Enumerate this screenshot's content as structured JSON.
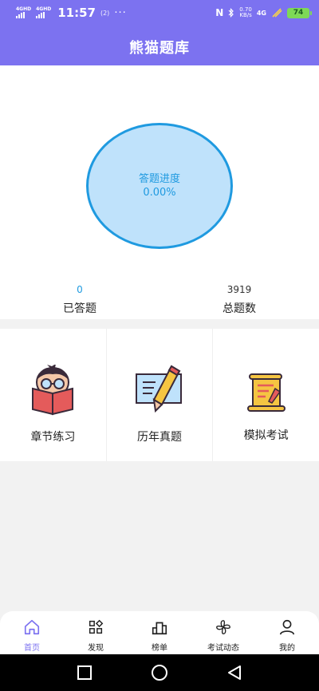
{
  "status_bar": {
    "network1": "4GHD",
    "network2": "4GHD",
    "time": "11:57",
    "hd_badge": "(2)",
    "more": "···",
    "nfc": "N",
    "speed_value": "0.70",
    "speed_unit": "KB/s",
    "net_type": "4G",
    "battery": "74"
  },
  "header": {
    "title": "熊猫题库"
  },
  "progress": {
    "label": "答题进度",
    "value": "0.00%"
  },
  "stats": {
    "answered": {
      "value": "0",
      "label": "已答题"
    },
    "total": {
      "value": "3919",
      "label": "总题数"
    }
  },
  "menu": {
    "chapter": "章节练习",
    "past_exams": "历年真题",
    "mock_exam": "模拟考试"
  },
  "tabbar": {
    "home": "首页",
    "discover": "发现",
    "ranking": "榜单",
    "exam_news": "考试动态",
    "mine": "我的",
    "active_color": "#7c72f0"
  },
  "colors": {
    "brand": "#7c72f0",
    "accent": "#1f9ae0",
    "circle_fill": "#bfe2fb"
  }
}
